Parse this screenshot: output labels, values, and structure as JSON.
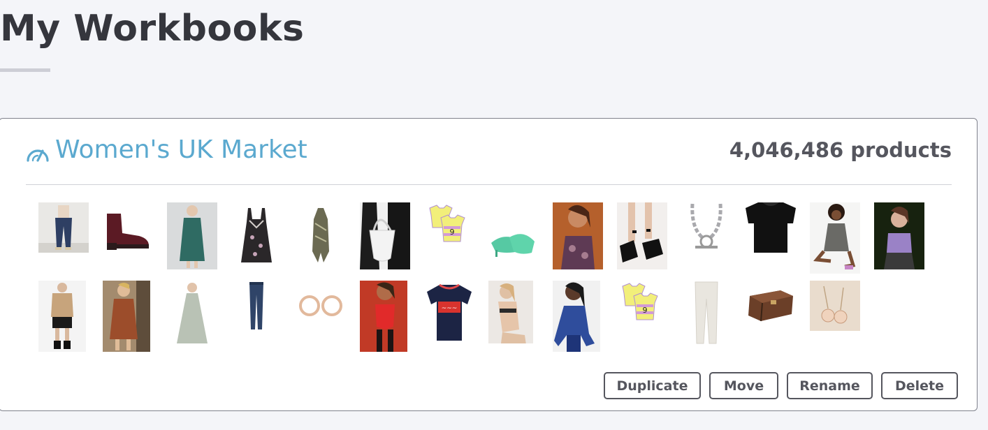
{
  "page": {
    "title": "My Workbooks"
  },
  "workbook": {
    "name": "Women's UK Market",
    "product_count": "4,046,486 products",
    "icon": "gauge-icon",
    "accent_color": "#5ba9cf"
  },
  "products": [
    {
      "name": "navy-trousers",
      "row": 1
    },
    {
      "name": "burgundy-ankle-boots",
      "row": 1
    },
    {
      "name": "teal-wrap-dress",
      "row": 1
    },
    {
      "name": "floral-lace-slip-dress",
      "row": 1
    },
    {
      "name": "printed-halter-top",
      "row": 1
    },
    {
      "name": "white-shoulder-bag",
      "row": 1
    },
    {
      "name": "striped-football-shirt",
      "row": 1
    },
    {
      "name": "mint-heeled-mules",
      "row": 1
    },
    {
      "name": "butterfly-print-cami",
      "row": 1
    },
    {
      "name": "black-platform-sandals",
      "row": 1
    },
    {
      "name": "silver-chain-necklace",
      "row": 1
    },
    {
      "name": "black-mesh-top",
      "row": 1
    },
    {
      "name": "printed-mini-dress",
      "row": 1
    },
    {
      "name": "purple-tie-dye-top",
      "row": 1
    },
    {
      "name": "camel-cardigan-shorts",
      "row": 2
    },
    {
      "name": "brown-shirt-dress",
      "row": 2
    },
    {
      "name": "sage-maxi-dress",
      "row": 2
    },
    {
      "name": "skinny-jeans",
      "row": 2
    },
    {
      "name": "gold-hoop-earrings",
      "row": 2
    },
    {
      "name": "red-swimsuit",
      "row": 2
    },
    {
      "name": "graphic-ringer-tee",
      "row": 2
    },
    {
      "name": "lingerie-set",
      "row": 2
    },
    {
      "name": "blue-sheer-top",
      "row": 2
    },
    {
      "name": "striped-football-shirt",
      "row": 2
    },
    {
      "name": "cream-trousers",
      "row": 2
    },
    {
      "name": "monogram-trunk-bag",
      "row": 2
    },
    {
      "name": "drop-earrings",
      "row": 2
    }
  ],
  "actions": {
    "duplicate": "Duplicate",
    "move": "Move",
    "rename": "Rename",
    "delete": "Delete"
  }
}
